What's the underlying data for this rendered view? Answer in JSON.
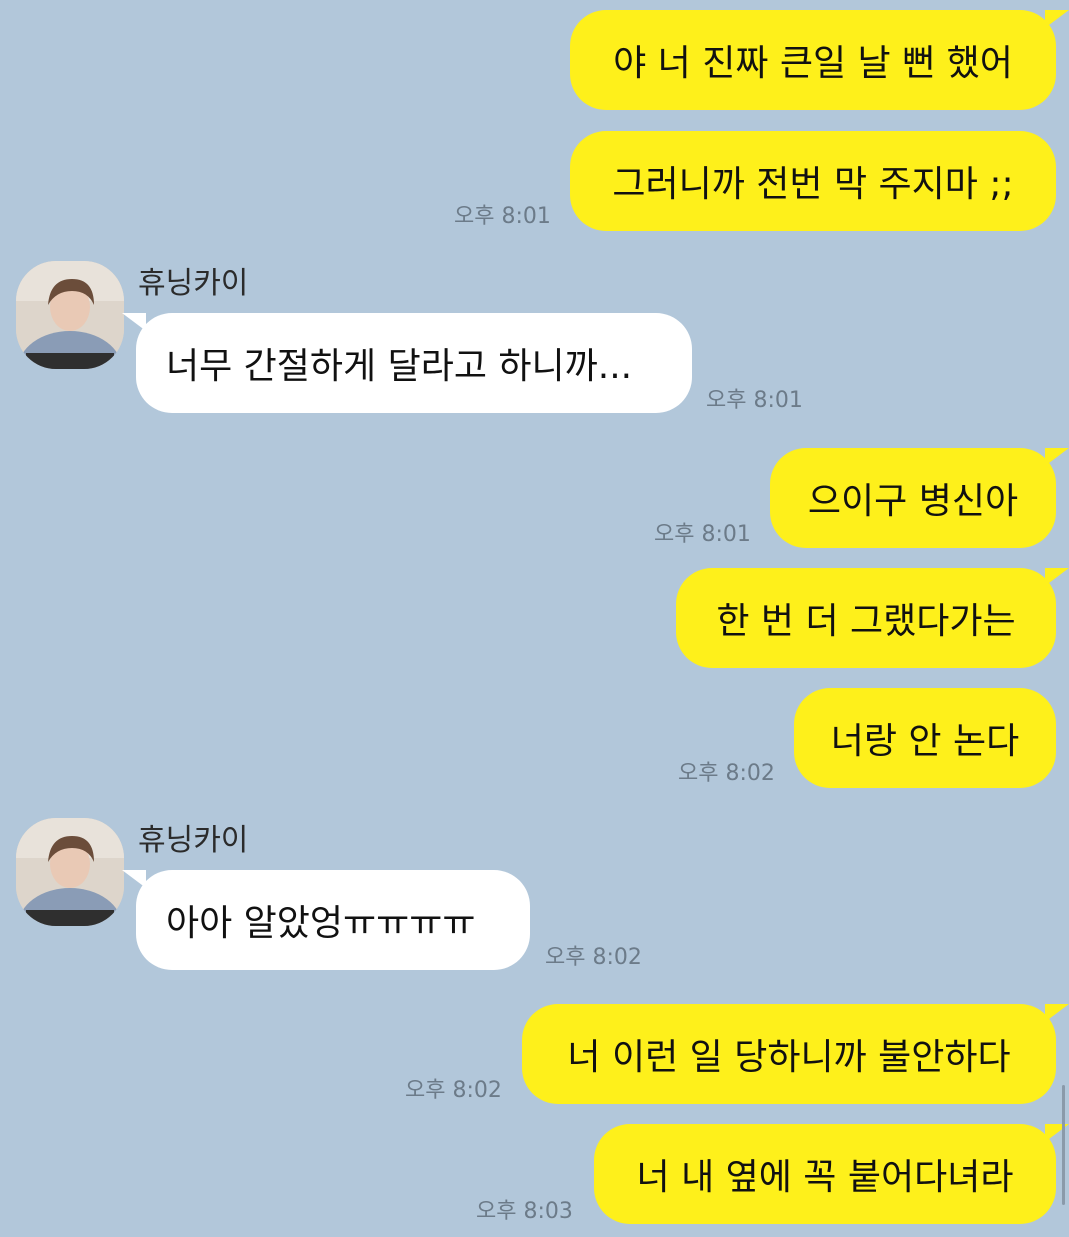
{
  "colors": {
    "background": "#b2c7da",
    "my_bubble": "#fef01b",
    "other_bubble": "#ffffff",
    "timestamp": "#6c7b89"
  },
  "messages": [
    {
      "sender": "me",
      "text": "야 너 진짜 큰일 날 뻔 했어",
      "time": ""
    },
    {
      "sender": "me",
      "text": "그러니까 전번 막 주지마 ;;",
      "time": "오후 8:01"
    },
    {
      "sender": "휴닝카이",
      "text": "너무 간절하게 달라고 하니까...",
      "time": "오후 8:01"
    },
    {
      "sender": "me",
      "text": "으이구 병신아",
      "time": "오후 8:01"
    },
    {
      "sender": "me",
      "text": "한 번 더 그랬다가는",
      "time": ""
    },
    {
      "sender": "me",
      "text": "너랑 안 논다",
      "time": "오후 8:02"
    },
    {
      "sender": "휴닝카이",
      "text": "아아 알았엉ㅠㅠㅠㅠ",
      "time": "오후 8:02"
    },
    {
      "sender": "me",
      "text": "너 이런 일 당하니까 불안하다",
      "time": "오후 8:02"
    },
    {
      "sender": "me",
      "text": "너 내 옆에 꼭 붙어다녀라",
      "time": "오후 8:03"
    }
  ],
  "avatar_icon": "profile-photo"
}
